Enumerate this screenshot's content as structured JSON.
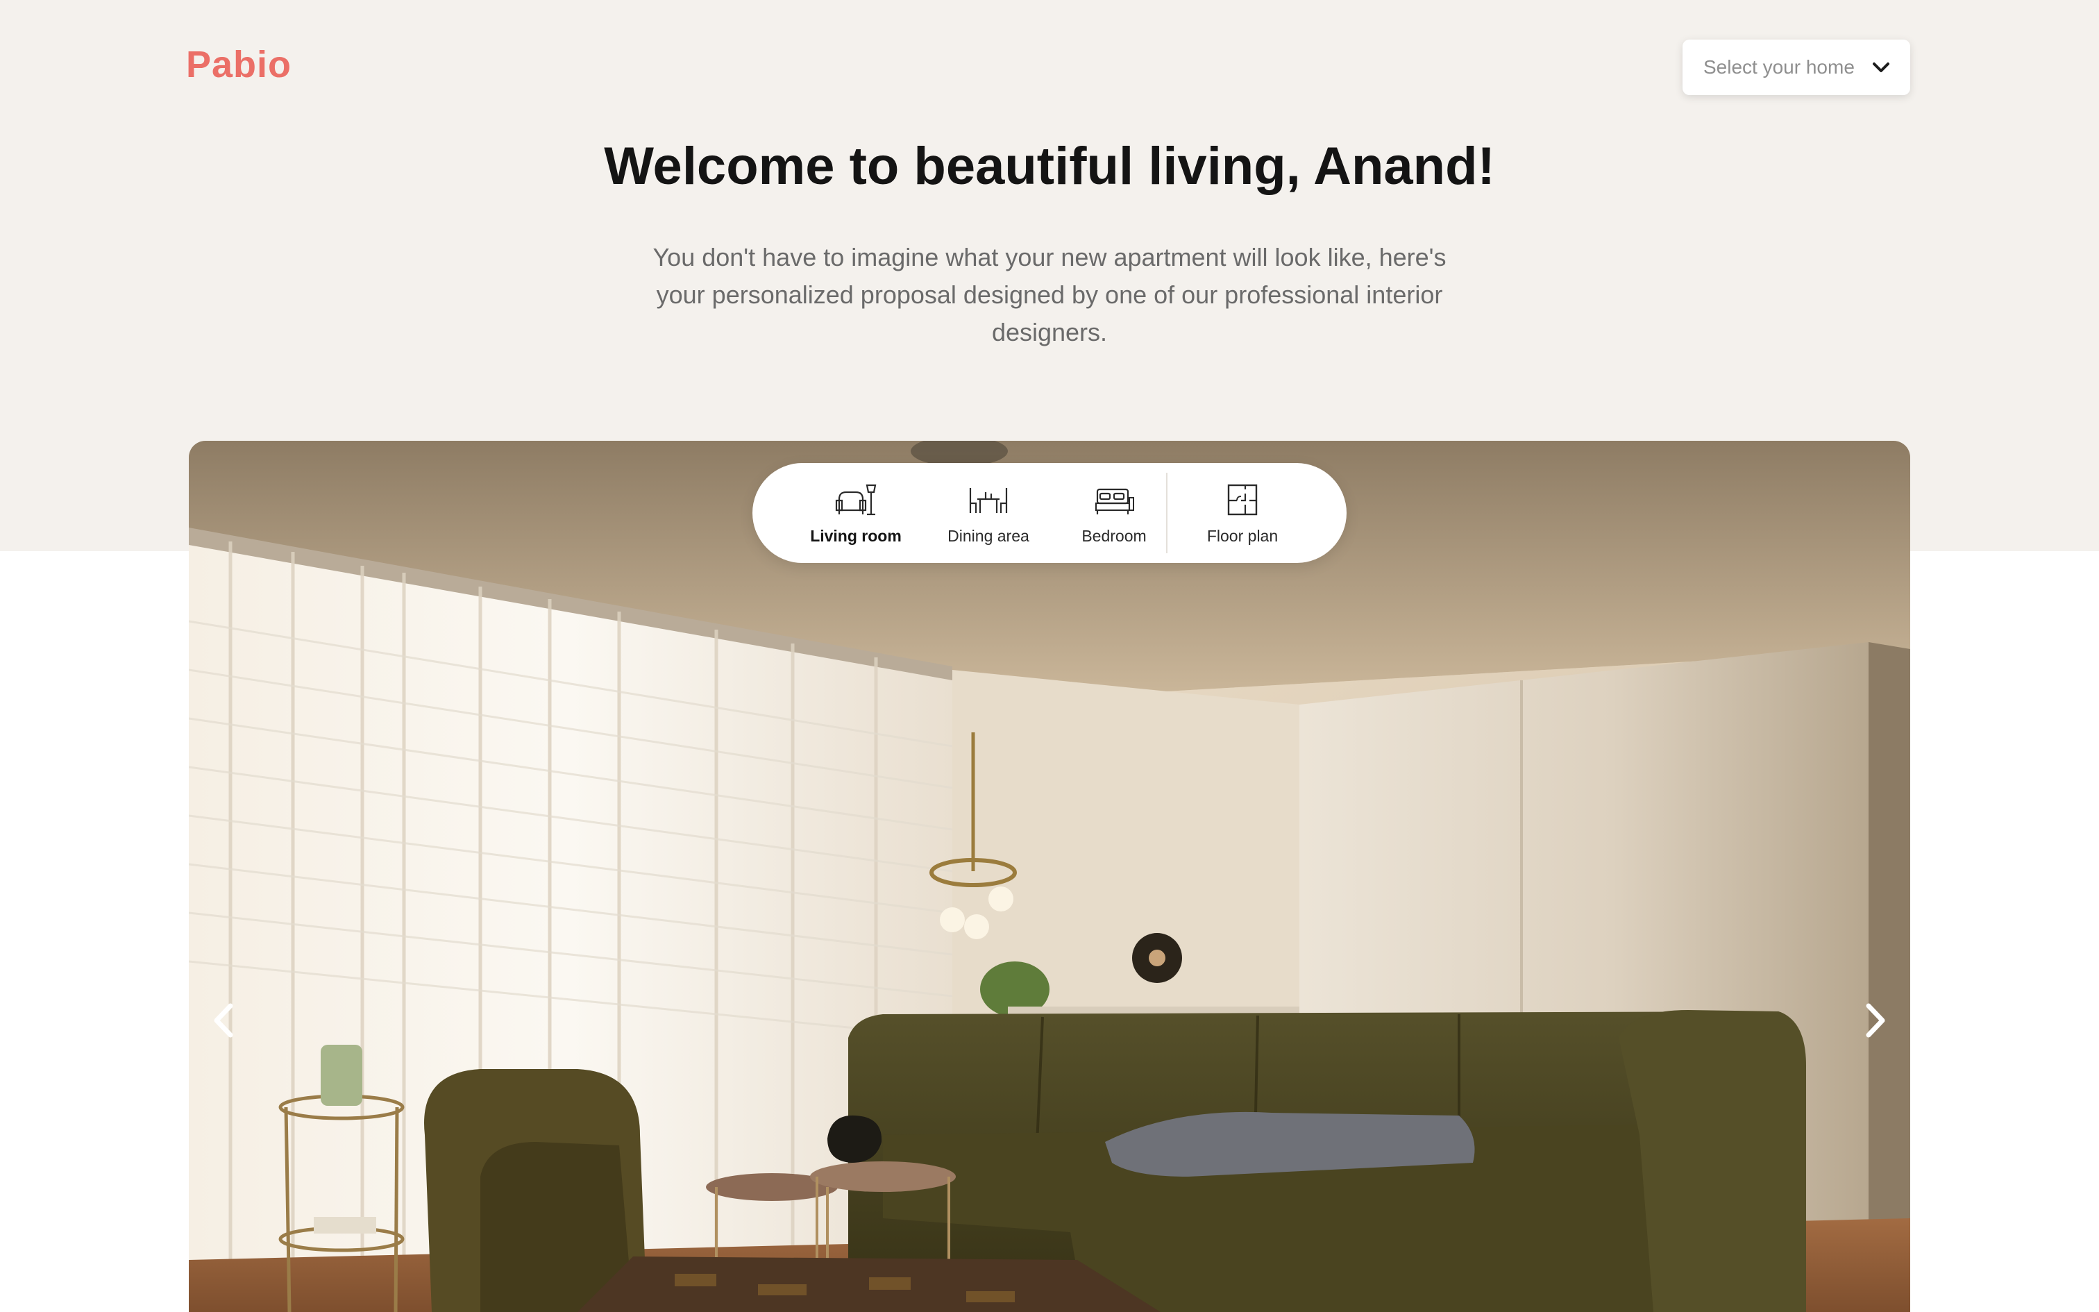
{
  "brand": {
    "name": "Pabio",
    "color": "#eb6f67"
  },
  "header": {
    "home_select_placeholder": "Select your home"
  },
  "hero": {
    "title": "Welcome to beautiful living, Anand!",
    "subtitle": "You don't have to imagine what your new apartment will look like, here's your personalized proposal designed by one of our professional interior designers."
  },
  "room_tabs": [
    {
      "label": "Living room",
      "icon": "armchair-lamp-icon",
      "active": true
    },
    {
      "label": "Dining area",
      "icon": "dining-table-icon",
      "active": false
    },
    {
      "label": "Bedroom",
      "icon": "bed-icon",
      "active": false
    },
    {
      "label": "Floor plan",
      "icon": "floor-plan-icon",
      "active": false
    }
  ],
  "carousel": {
    "prev_icon": "chevron-left-icon",
    "next_icon": "chevron-right-icon",
    "image": "Rendered living room with olive green sectional sofa, armchair, side tables, chandelier and white wardrobe"
  },
  "colors": {
    "hero_background": "#f4f1ed",
    "page_background": "#ffffff",
    "title_text": "#141414",
    "body_text": "#6a6a6a"
  }
}
